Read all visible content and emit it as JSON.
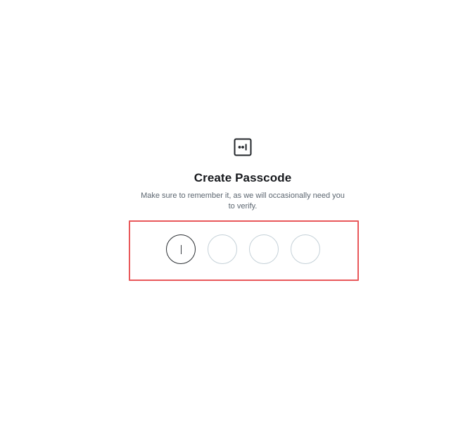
{
  "passcode": {
    "icon": "passcode-icon",
    "title": "Create Passcode",
    "subtitle": "Make sure to remember it, as we will occasionally need you to verify.",
    "digits": [
      {
        "value": "",
        "state": "active"
      },
      {
        "value": "",
        "state": "empty"
      },
      {
        "value": "",
        "state": "empty"
      },
      {
        "value": "",
        "state": "empty"
      }
    ]
  },
  "colors": {
    "highlight_border": "#e9585a",
    "active_circle": "#2b2f33",
    "idle_circle": "#c5d1d8",
    "title": "#16181c",
    "subtitle": "#5c6670"
  }
}
